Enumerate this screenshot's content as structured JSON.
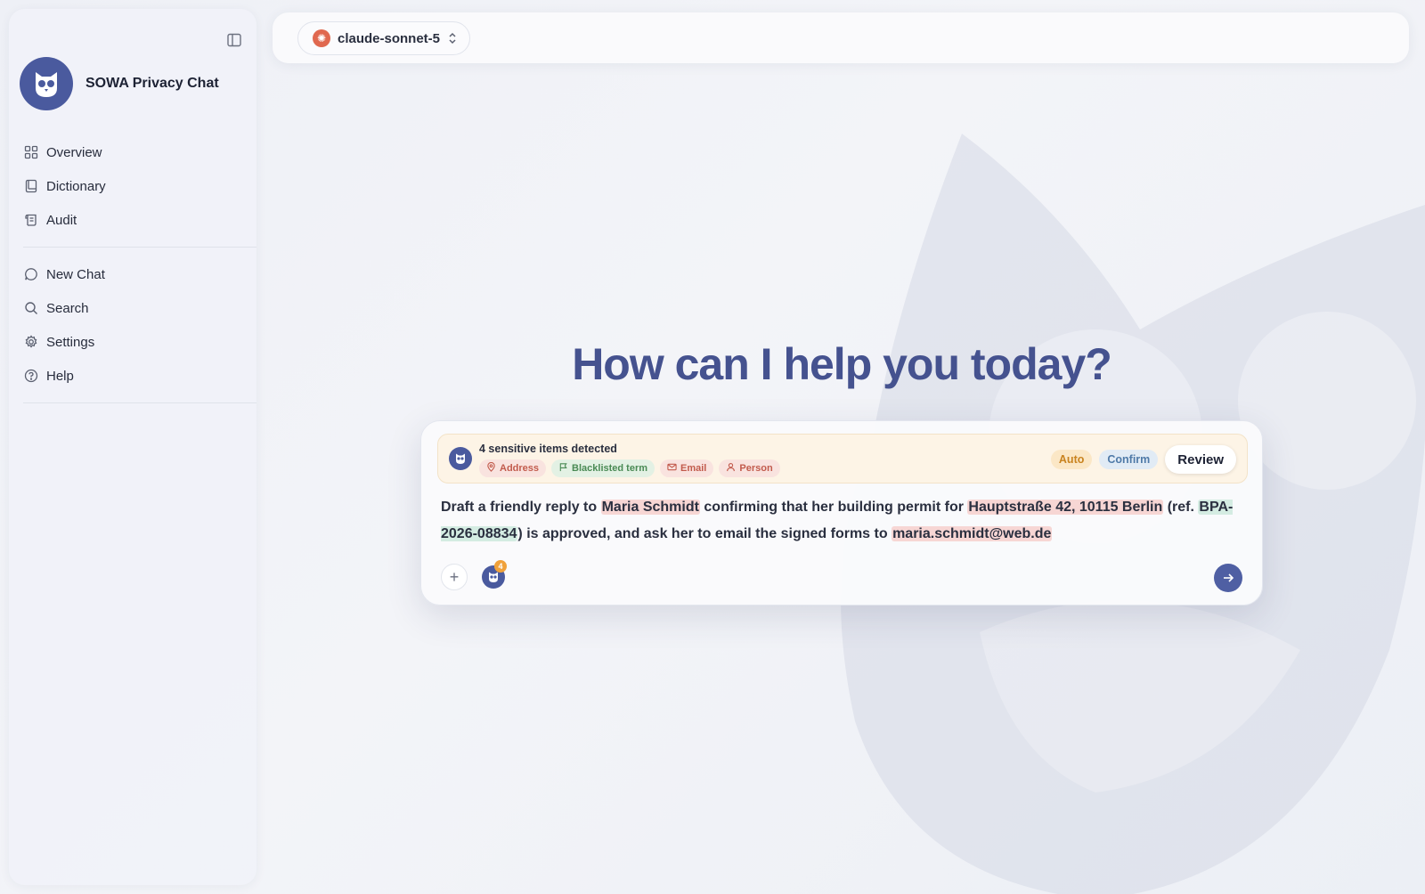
{
  "app": {
    "name": "SOWA Privacy Chat"
  },
  "sidebar": {
    "primary": [
      {
        "label": "Overview",
        "icon": "grid-icon"
      },
      {
        "label": "Dictionary",
        "icon": "book-icon"
      },
      {
        "label": "Audit",
        "icon": "scroll-icon"
      }
    ],
    "secondary": [
      {
        "label": "New Chat",
        "icon": "chat-bubble-icon"
      },
      {
        "label": "Search",
        "icon": "search-icon"
      },
      {
        "label": "Settings",
        "icon": "gear-icon"
      },
      {
        "label": "Help",
        "icon": "help-circle-icon"
      }
    ]
  },
  "topbar": {
    "model": "claude-sonnet-5"
  },
  "hero": {
    "title": "How can I help you today?"
  },
  "detection": {
    "title": "4 sensitive items detected",
    "chips": [
      {
        "label": "Address",
        "kind": "red",
        "icon": "map-pin-icon"
      },
      {
        "label": "Blacklisted term",
        "kind": "green",
        "icon": "flag-icon"
      },
      {
        "label": "Email",
        "kind": "red",
        "icon": "mail-icon"
      },
      {
        "label": "Person",
        "kind": "red",
        "icon": "person-icon"
      }
    ],
    "modes": {
      "auto": "Auto",
      "confirm": "Confirm",
      "review": "Review"
    }
  },
  "prompt": {
    "segments": [
      {
        "text": "Draft a friendly reply to ",
        "hl": ""
      },
      {
        "text": "Maria Schmidt",
        "hl": "red"
      },
      {
        "text": " confirming that her building permit for ",
        "hl": ""
      },
      {
        "text": "Hauptstraße 42, 10115 Berlin",
        "hl": "red"
      },
      {
        "text": " (ref. ",
        "hl": ""
      },
      {
        "text": "BPA-2026-08834",
        "hl": "green"
      },
      {
        "text": ") is approved, and ask her to email the signed forms to ",
        "hl": ""
      },
      {
        "text": "maria.schmidt@web.de",
        "hl": "red"
      }
    ]
  },
  "composer": {
    "badge_count": "4"
  },
  "colors": {
    "accent": "#4f5fa3",
    "heading": "#45528f",
    "alert_bg": "#fdf4e6"
  }
}
